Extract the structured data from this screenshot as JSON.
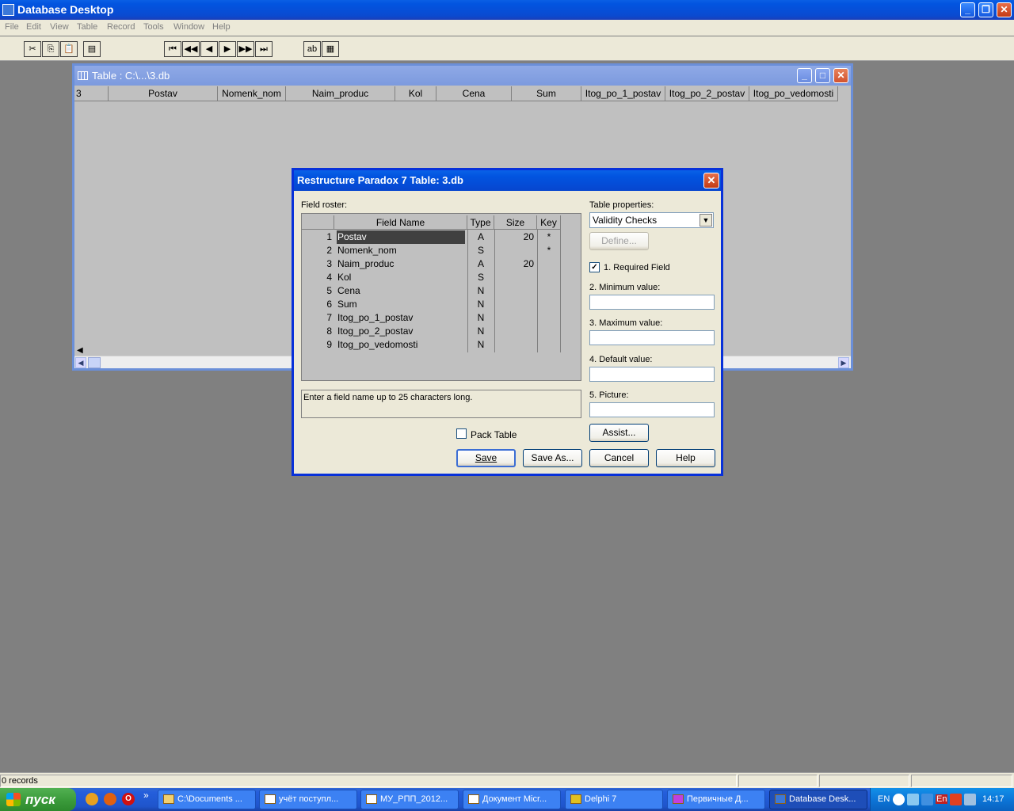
{
  "app": {
    "title": "Database Desktop",
    "controls": {
      "minimize": "_",
      "restore": "❐",
      "close": "✕"
    }
  },
  "menu": [
    "File",
    "Edit",
    "View",
    "Table",
    "Record",
    "Tools",
    "Window",
    "Help"
  ],
  "toolbar": {
    "cut": "✂",
    "copy": "⎘",
    "paste": "📋",
    "tool4": "▤",
    "first": "⏮",
    "prev_set": "◀◀",
    "prev": "◀",
    "next": "▶",
    "next_set": "▶▶",
    "last": "⏭",
    "tool11": "ab",
    "tool12": "▦"
  },
  "table_window": {
    "title": "Table : C:\\...\\3.db",
    "columns": [
      "3",
      "Postav",
      "Nomenk_nom",
      "Naim_produc",
      "Kol",
      "Cena",
      "Sum",
      "Itog_po_1_postav",
      "Itog_po_2_postav",
      "Itog_po_vedomosti"
    ],
    "scroll_left": "◀",
    "scroll_right": "▶",
    "pane_marker": "◀"
  },
  "dialog": {
    "title": "Restructure Paradox 7 Table: 3.db",
    "close": "✕",
    "field_roster_label": "Field roster:",
    "headers": {
      "name": "Field Name",
      "type": "Type",
      "size": "Size",
      "key": "Key"
    },
    "fields": [
      {
        "num": "1",
        "name": "Postav",
        "type": "A",
        "size": "20",
        "key": "*"
      },
      {
        "num": "2",
        "name": "Nomenk_nom",
        "type": "S",
        "size": "",
        "key": "*"
      },
      {
        "num": "3",
        "name": "Naim_produc",
        "type": "A",
        "size": "20",
        "key": ""
      },
      {
        "num": "4",
        "name": "Kol",
        "type": "S",
        "size": "",
        "key": ""
      },
      {
        "num": "5",
        "name": "Cena",
        "type": "N",
        "size": "",
        "key": ""
      },
      {
        "num": "6",
        "name": "Sum",
        "type": "N",
        "size": "",
        "key": ""
      },
      {
        "num": "7",
        "name": "Itog_po_1_postav",
        "type": "N",
        "size": "",
        "key": ""
      },
      {
        "num": "8",
        "name": "Itog_po_2_postav",
        "type": "N",
        "size": "",
        "key": ""
      },
      {
        "num": "9",
        "name": "Itog_po_vedomosti",
        "type": "N",
        "size": "",
        "key": ""
      }
    ],
    "hint": "Enter a field name up to 25 characters long.",
    "pack_table_label": "Pack Table",
    "pack_table_checked": false,
    "table_properties_label": "Table properties:",
    "table_properties_value": "Validity Checks",
    "define_label": "Define...",
    "required_field_label": "1. Required Field",
    "required_field_checked": true,
    "required_check_glyph": "✓",
    "minimum_label": "2. Minimum value:",
    "minimum_value": "",
    "maximum_label": "3. Maximum value:",
    "maximum_value": "",
    "default_label": "4. Default value:",
    "default_value": "",
    "picture_label": "5. Picture:",
    "picture_value": "",
    "assist_label": "Assist...",
    "save_label": "Save",
    "save_as_label": "Save As...",
    "cancel_label": "Cancel",
    "help_label": "Help",
    "dropdown_glyph": "▼"
  },
  "status": {
    "records": "0 records"
  },
  "taskbar": {
    "start_label": "пуск",
    "more": "»",
    "tasks": [
      "C:\\Documents ...",
      "учёт поступл...",
      "МУ_РПП_2012...",
      "Документ Micr...",
      "Delphi 7",
      "Первичные Д...",
      "Database Desk..."
    ],
    "lang": "EN",
    "lang2": "En",
    "clock": "14:17"
  }
}
